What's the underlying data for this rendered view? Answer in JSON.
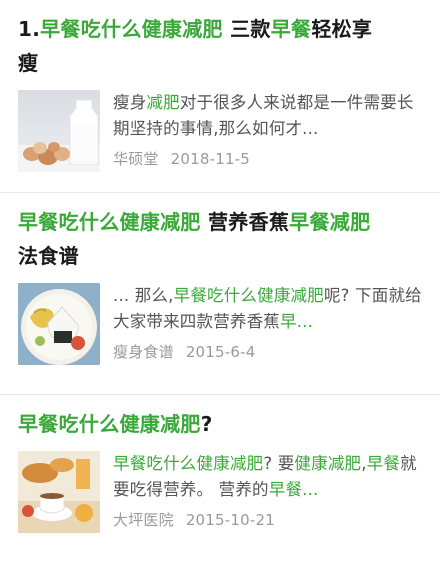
{
  "results": [
    {
      "title": [
        "1.",
        {
          "hl": "早餐吃什么健康减肥"
        },
        " 三款",
        {
          "hl": "早餐"
        },
        "轻松享",
        "\n",
        "瘦"
      ],
      "snippet": [
        "瘦身",
        {
          "hl": "减肥"
        },
        "对于很多人来说都是一件需要长期坚持的事情,那么如何才..."
      ],
      "source": "华硕堂",
      "date": "2018-11-5",
      "thumbnail_icon": "eggs-and-milk-photo"
    },
    {
      "title": [
        {
          "hl": "早餐吃什么健康减肥"
        },
        " 营养香蕉",
        {
          "hl": "早餐减肥"
        },
        "\n",
        "法食谱"
      ],
      "snippet": [
        "... 那么,",
        {
          "hl": "早餐吃什么健康减肥"
        },
        "呢? 下面就给大家带来四款营养香蕉",
        {
          "hl": "早..."
        }
      ],
      "source": "瘦身食谱",
      "date": "2015-6-4",
      "thumbnail_icon": "rice-ball-plate-photo"
    },
    {
      "title": [
        {
          "hl": "早餐吃什么健康减肥"
        },
        "?"
      ],
      "snippet": [
        {
          "hl": "早餐吃什么健康减肥"
        },
        "? 要",
        {
          "hl": "健康减肥"
        },
        ",",
        {
          "hl": "早餐"
        },
        "就要吃得营养。 营养的",
        {
          "hl": "早餐..."
        }
      ],
      "source": "大坪医院",
      "date": "2015-10-21",
      "thumbnail_icon": "breakfast-table-photo"
    }
  ],
  "colors": {
    "highlight": "#3aa93a",
    "title_text": "#1a1a1a",
    "snippet_text": "#555555",
    "meta_text": "#9a9a9a",
    "divider": "#e6e6e6"
  }
}
